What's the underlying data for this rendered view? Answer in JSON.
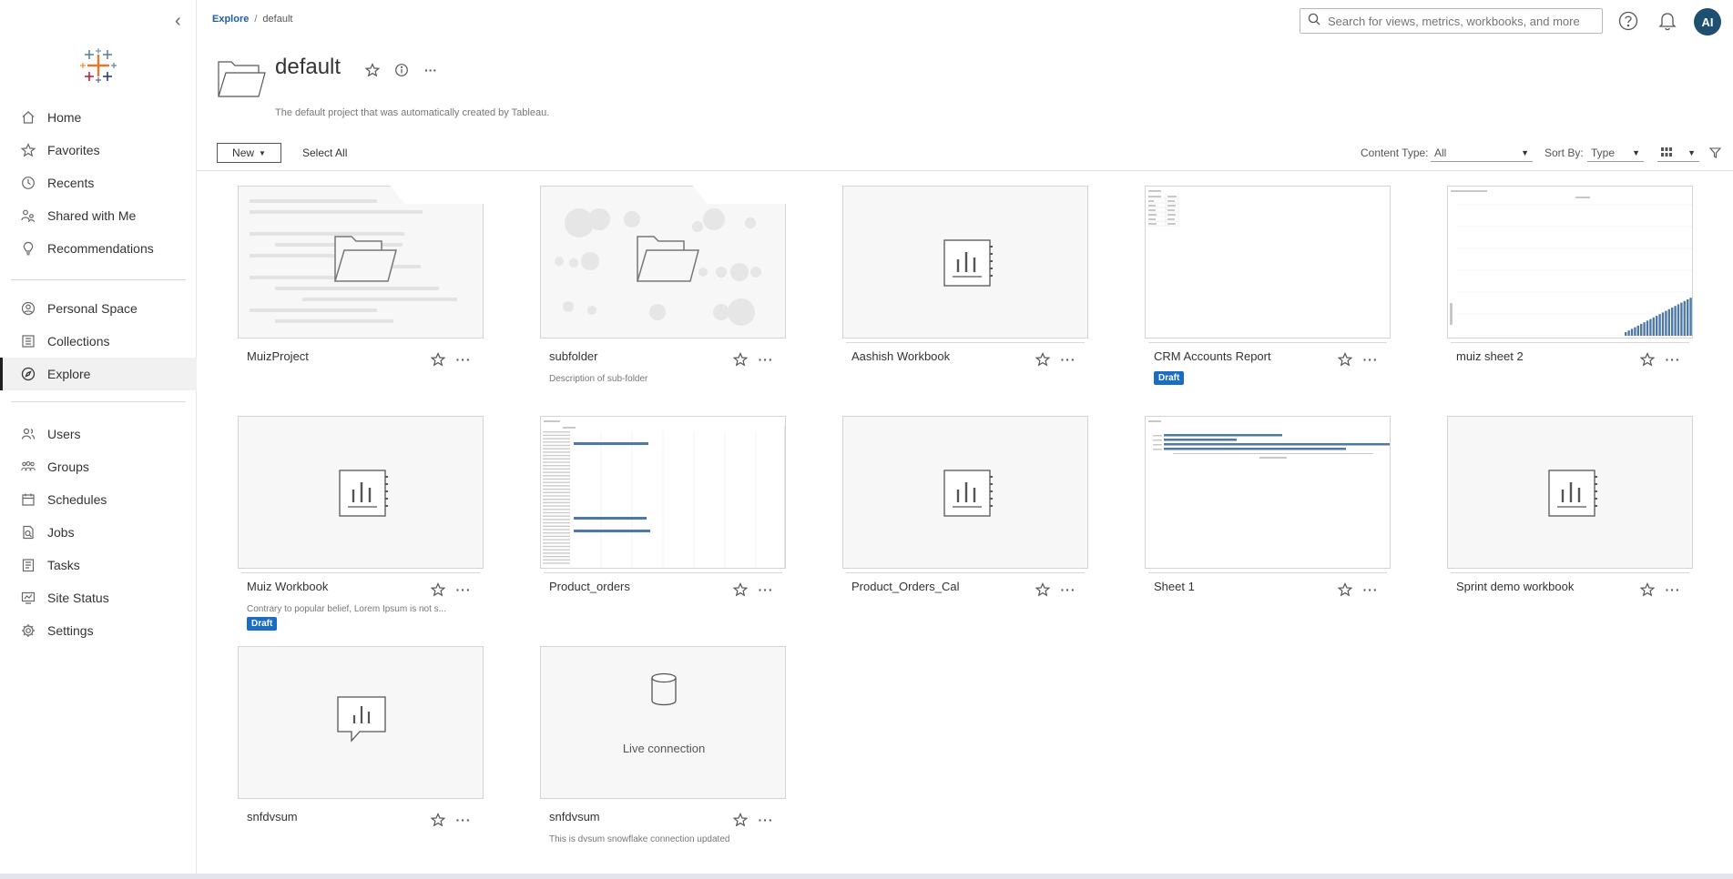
{
  "breadcrumb": {
    "root": "Explore",
    "current": "default"
  },
  "search": {
    "placeholder": "Search for views, metrics, workbooks, and more"
  },
  "user": {
    "initials": "AI"
  },
  "sidebar": {
    "group1": [
      {
        "label": "Home",
        "icon": "home-icon"
      },
      {
        "label": "Favorites",
        "icon": "star-icon"
      },
      {
        "label": "Recents",
        "icon": "clock-icon"
      },
      {
        "label": "Shared with Me",
        "icon": "people-icon"
      },
      {
        "label": "Recommendations",
        "icon": "bulb-icon"
      }
    ],
    "group2": [
      {
        "label": "Personal Space",
        "icon": "person-circle-icon"
      },
      {
        "label": "Collections",
        "icon": "collections-icon"
      },
      {
        "label": "Explore",
        "icon": "compass-icon"
      }
    ],
    "group3": [
      {
        "label": "Users",
        "icon": "users-icon"
      },
      {
        "label": "Groups",
        "icon": "groups-icon"
      },
      {
        "label": "Schedules",
        "icon": "calendar-icon"
      },
      {
        "label": "Jobs",
        "icon": "jobs-icon"
      },
      {
        "label": "Tasks",
        "icon": "tasks-icon"
      },
      {
        "label": "Site Status",
        "icon": "site-status-icon"
      },
      {
        "label": "Settings",
        "icon": "gear-icon"
      }
    ],
    "active": "Explore"
  },
  "header": {
    "title": "default",
    "description": "The default project that was automatically created by Tableau."
  },
  "toolbar": {
    "new_label": "New",
    "select_all_label": "Select All",
    "content_type_label": "Content Type:",
    "content_type_value": "All",
    "sort_by_label": "Sort By:",
    "sort_by_value": "Type"
  },
  "cards": [
    {
      "name": "MuizProject",
      "kind": "project",
      "description": "",
      "badge": ""
    },
    {
      "name": "subfolder",
      "kind": "project",
      "description": "Description of sub-folder",
      "badge": ""
    },
    {
      "name": "Aashish Workbook",
      "kind": "workbook",
      "description": "",
      "badge": ""
    },
    {
      "name": "CRM Accounts Report",
      "kind": "workbook",
      "description": "",
      "badge": "Draft"
    },
    {
      "name": "muiz sheet 2",
      "kind": "workbook",
      "description": "",
      "badge": ""
    },
    {
      "name": "Muiz Workbook",
      "kind": "workbook",
      "description": "Contrary to popular belief, Lorem Ipsum is not s...",
      "badge": "Draft"
    },
    {
      "name": "Product_orders",
      "kind": "workbook",
      "description": "",
      "badge": ""
    },
    {
      "name": "Product_Orders_Cal",
      "kind": "workbook",
      "description": "",
      "badge": ""
    },
    {
      "name": "Sheet 1",
      "kind": "workbook",
      "description": "",
      "badge": ""
    },
    {
      "name": "Sprint demo workbook",
      "kind": "workbook",
      "description": "",
      "badge": ""
    },
    {
      "name": "snfdvsum",
      "kind": "metric",
      "description": "",
      "badge": ""
    },
    {
      "name": "snfdvsum",
      "kind": "datasource",
      "description": "This is dvsum snowflake connection updated",
      "badge": "",
      "thumb_text": "Live connection"
    }
  ]
}
